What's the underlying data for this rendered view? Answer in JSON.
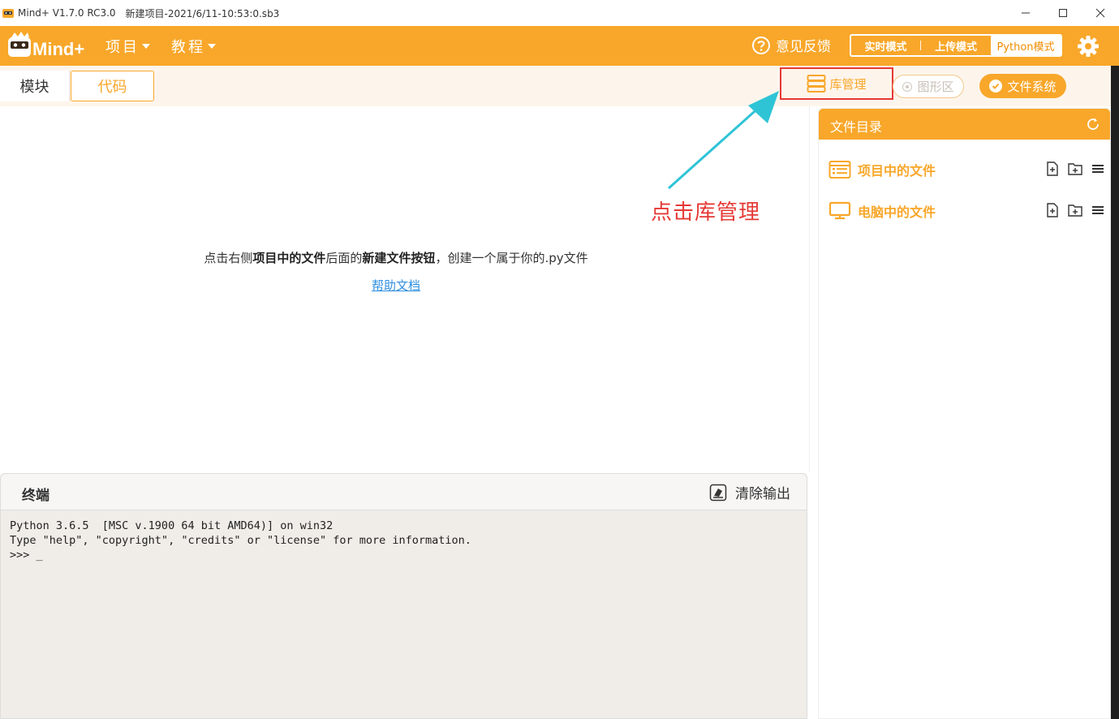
{
  "window": {
    "app_name": "Mind+ V1.7.0 RC3.0",
    "file_name": "新建项目-2021/6/11-10:53:0.sb3"
  },
  "header": {
    "logo_text": "Mind+",
    "menu": [
      {
        "label": "项目"
      },
      {
        "label": "教程"
      }
    ],
    "feedback_label": "意见反馈",
    "modes": {
      "realtime": "实时模式",
      "upload": "上传模式",
      "python": "Python模式"
    }
  },
  "tabs": {
    "blocks": "模块",
    "code": "代码"
  },
  "toolbar": {
    "library": "库管理",
    "graphics": "图形区",
    "filesystem": "文件系统"
  },
  "editor": {
    "hint_part1": "点击右侧",
    "hint_bold1": "项目中的文件",
    "hint_part2": "后面的",
    "hint_bold2": "新建文件按钮",
    "hint_part3": "，创建一个属于你的.py文件",
    "help_link": "帮助文档"
  },
  "annotation": {
    "text": "点击库管理"
  },
  "terminal": {
    "title": "终端",
    "clear_label": "清除输出",
    "lines": [
      "Python 3.6.5  [MSC v.1900 64 bit AMD64)] on win32",
      "Type \"help\", \"copyright\", \"credits\" or \"license\" for more information.",
      ">>> _"
    ]
  },
  "file_panel": {
    "title": "文件目录",
    "project_files": "项目中的文件",
    "computer_files": "电脑中的文件"
  },
  "colors": {
    "brand_orange": "#f8a72a",
    "highlight_red": "#e53935",
    "annotation_arrow": "#2ec4d6",
    "link_blue": "#2f8fe0"
  }
}
